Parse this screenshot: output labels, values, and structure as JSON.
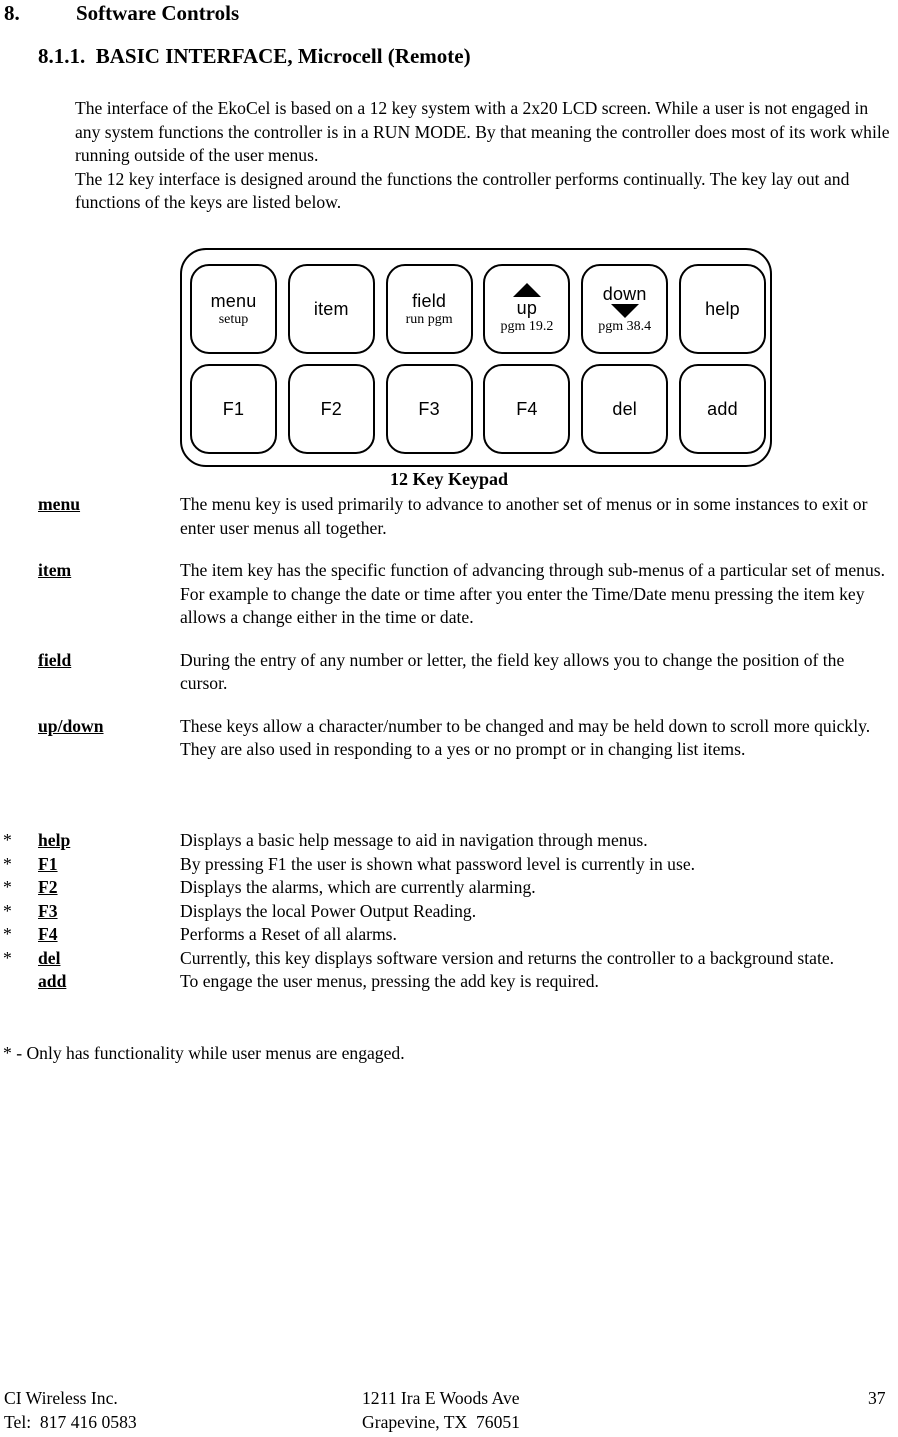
{
  "heading": {
    "section_number": "8.",
    "section_title": "Software Controls",
    "subsection": "8.1.1.  BASIC INTERFACE, Microcell (Remote)"
  },
  "intro": {
    "paragraph_1": "The interface of the EkoCel is based on a 12 key system with a 2x20 LCD screen. While a user is not engaged in any system functions the controller is in a RUN MODE.  By that meaning the controller does most of its work while running outside of the user menus.",
    "paragraph_2": "The 12 key interface is designed around the functions the controller performs continually.  The key lay out and functions of the keys are listed below."
  },
  "keypad": {
    "caption": "12 Key Keypad",
    "row_top": [
      {
        "label": "menu",
        "sub": "setup",
        "arrow": "none"
      },
      {
        "label": "item",
        "sub": "",
        "arrow": "none"
      },
      {
        "label": "field",
        "sub": "run pgm",
        "arrow": "none"
      },
      {
        "label": "up",
        "sub": "pgm 19.2",
        "arrow": "up"
      },
      {
        "label": "down",
        "sub": "pgm 38.4",
        "arrow": "down"
      },
      {
        "label": "help",
        "sub": "",
        "arrow": "none"
      }
    ],
    "row_bottom": [
      {
        "label": "F1",
        "sub": "",
        "arrow": "none"
      },
      {
        "label": "F2",
        "sub": "",
        "arrow": "none"
      },
      {
        "label": "F3",
        "sub": "",
        "arrow": "none"
      },
      {
        "label": "F4",
        "sub": "",
        "arrow": "none"
      },
      {
        "label": "del",
        "sub": "",
        "arrow": "none"
      },
      {
        "label": "add",
        "sub": "",
        "arrow": "none"
      }
    ]
  },
  "definitions": [
    {
      "term": "menu",
      "description": "The menu key is used primarily to advance to another set of menus or in some instances to exit or enter user menus all together."
    },
    {
      "term": "item",
      "description": "The item key has the specific function of advancing through sub-menus of a particular set of  menus.  For example to change the date or time after you enter the Time/Date menu pressing the item key allows a change either in the time or date."
    },
    {
      "term": "field",
      "description": "During the entry of any number or letter, the field key allows you to change the position of  the cursor."
    },
    {
      "term": "up/down",
      "description": "These keys allow a character/number to be changed and may be held down to scroll more quickly.  They are also used in responding to a yes or no prompt or in changing list items."
    }
  ],
  "starred_items": [
    {
      "mark": "*",
      "term": "help",
      "description": "Displays a basic help message to aid in navigation through menus."
    },
    {
      "mark": "*",
      "term": "F1",
      "description": "By pressing F1 the user is shown what password level is currently in use."
    },
    {
      "mark": "*",
      "term": "F2",
      "description": "Displays the alarms, which are currently alarming."
    },
    {
      "mark": "*",
      "term": "F3",
      "description": "Displays the local Power Output Reading."
    },
    {
      "mark": "*",
      "term": "F4",
      "description": "Performs a Reset of all alarms."
    },
    {
      "mark": "*",
      "term": "del",
      "description": "Currently, this key displays software version and returns the controller to a background state."
    },
    {
      "mark": "",
      "term": "add",
      "description": "To engage the user menus, pressing the add key is required."
    }
  ],
  "footnote": "* - Only has functionality while user menus are engaged.",
  "footer": {
    "company": "CI Wireless Inc.",
    "phone": "Tel:  817 416 0583",
    "address_line1": "1211 Ira E Woods Ave",
    "address_line2": "Grapevine, TX  76051",
    "page_number": "37"
  }
}
